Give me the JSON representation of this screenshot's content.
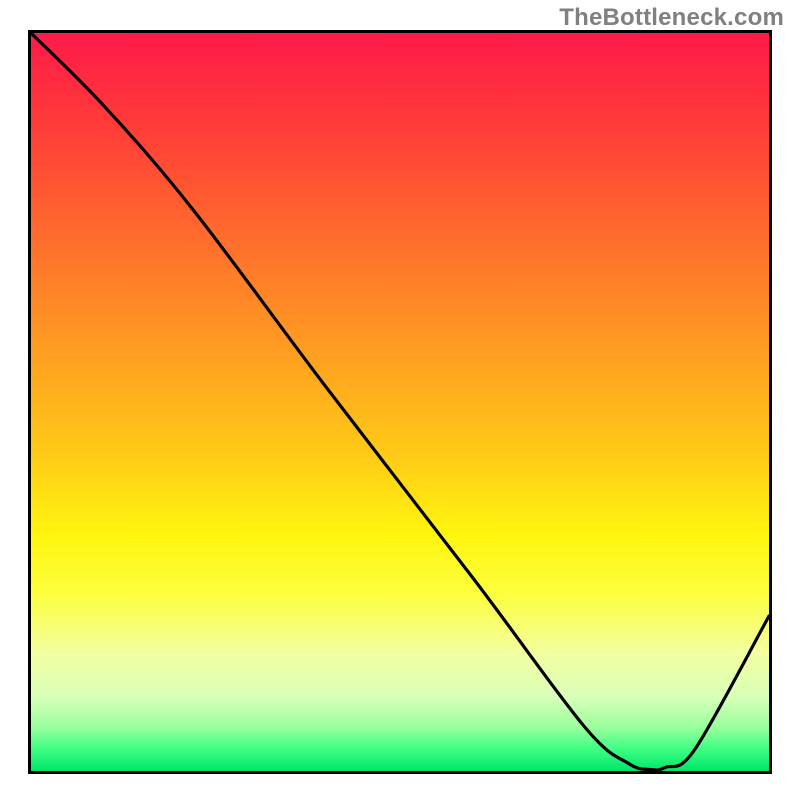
{
  "watermark": "TheBottleneck.com",
  "chart_data": {
    "type": "line",
    "title": "",
    "xlabel": "",
    "ylabel": "",
    "xlim": [
      0,
      100
    ],
    "ylim": [
      0,
      100
    ],
    "x": [
      0,
      10,
      22,
      40,
      60,
      75,
      81,
      84,
      86,
      90,
      100
    ],
    "values": [
      100,
      90,
      76,
      52,
      26,
      6,
      1,
      0.2,
      0.5,
      3,
      21
    ],
    "gradient_stops": [
      {
        "pos": 0,
        "color": "#ff1a49"
      },
      {
        "pos": 12,
        "color": "#ff3a39"
      },
      {
        "pos": 27,
        "color": "#ff6a2d"
      },
      {
        "pos": 42,
        "color": "#ff9a22"
      },
      {
        "pos": 57,
        "color": "#ffca17"
      },
      {
        "pos": 68,
        "color": "#fff50f"
      },
      {
        "pos": 76,
        "color": "#fcff3d"
      },
      {
        "pos": 84,
        "color": "#f3ffa0"
      },
      {
        "pos": 90,
        "color": "#d8ffb8"
      },
      {
        "pos": 94,
        "color": "#9cff9e"
      },
      {
        "pos": 97,
        "color": "#3fff84"
      },
      {
        "pos": 100,
        "color": "#00e56a"
      }
    ],
    "minimum_marker": {
      "x_start": 79,
      "x_end": 89,
      "y": 0.2,
      "color": "#c96a6e"
    }
  }
}
